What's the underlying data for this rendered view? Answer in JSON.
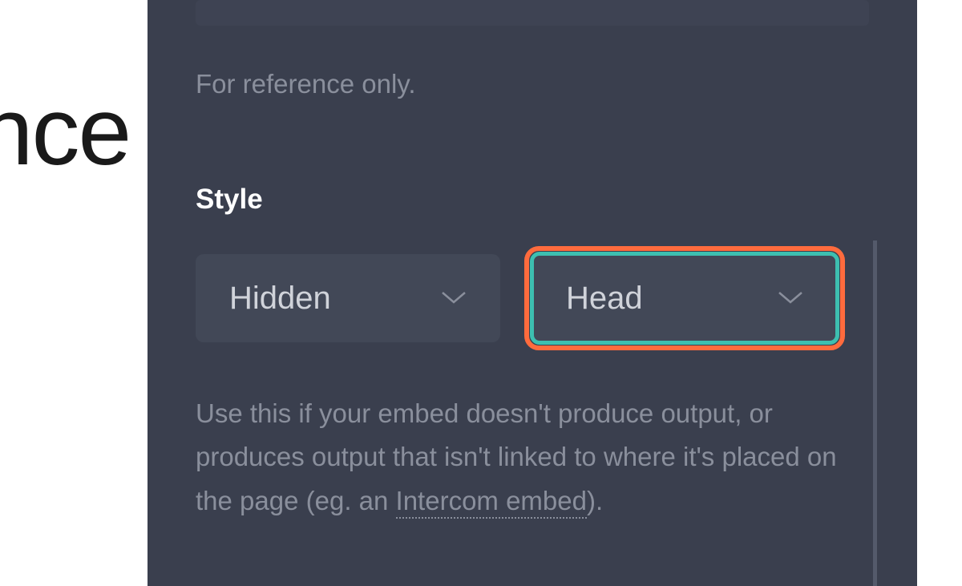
{
  "background": {
    "partial_text": "ance"
  },
  "panel": {
    "reference_note": "For reference only.",
    "style_section": {
      "label": "Style",
      "dropdown_visibility": {
        "selected": "Hidden"
      },
      "dropdown_position": {
        "selected": "Head"
      },
      "description_prefix": "Use this if your embed doesn't produce output, or produces output that isn't linked to where it's placed on the page (eg. an ",
      "description_link": "Intercom embed",
      "description_suffix": ")."
    }
  }
}
